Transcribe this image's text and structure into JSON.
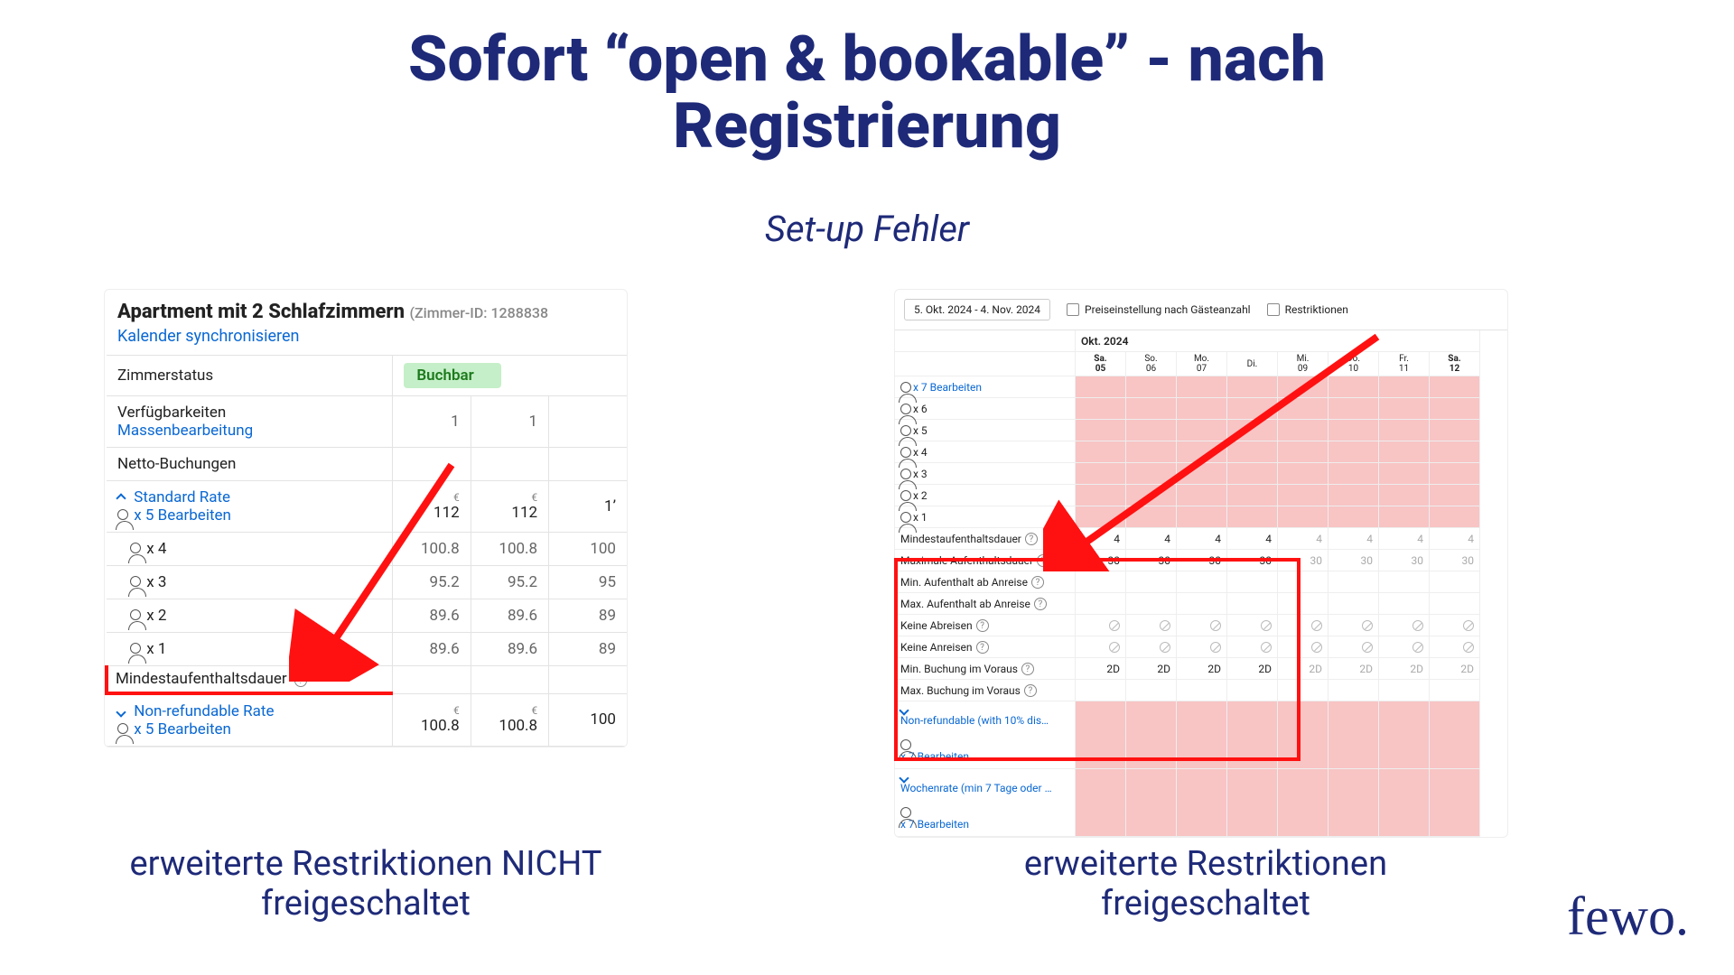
{
  "slide": {
    "title_line1": "Sofort “open & bookable” - nach",
    "title_line2": "Registrierung",
    "subtitle": "Set-up Fehler",
    "caption_left_line1": "erweiterte Restriktionen NICHT",
    "caption_left_line2": "freigeschaltet",
    "caption_right_line1": "erweiterte Restriktionen",
    "caption_right_line2": "freigeschaltet",
    "logo_text": "fewo."
  },
  "left_panel": {
    "apt_title": "Apartment mit 2 Schlafzimmern",
    "room_id_label": "(Zimmer-ID: 1288838",
    "sync_link": "Kalender synchronisieren",
    "status_label": "Zimmerstatus",
    "status_value": "Buchbar",
    "availability_label": "Verfügbarkeiten",
    "mass_edit": "Massenbearbeitung",
    "availability_vals": [
      "1",
      "1",
      ""
    ],
    "net_label": "Netto-Buchungen",
    "rate_std": "Standard Rate",
    "edit_x5": "x 5 Bearbeiten",
    "std_vals": [
      "112",
      "112",
      "1’"
    ],
    "occ4": "x 4",
    "occ4_vals": [
      "100.8",
      "100.8",
      "100"
    ],
    "occ3": "x 3",
    "occ3_vals": [
      "95.2",
      "95.2",
      "95"
    ],
    "occ2": "x 2",
    "occ2_vals": [
      "89.6",
      "89.6",
      "89"
    ],
    "occ1": "x 1",
    "occ1_vals": [
      "89.6",
      "89.6",
      "89"
    ],
    "minstay_label": "Mindestaufenthaltsdauer",
    "rate_nonref": "Non-refundable Rate",
    "nonref_vals": [
      "100.8",
      "100.8",
      "100"
    ]
  },
  "right_panel": {
    "date_range": "5. Okt. 2024 - 4. Nov. 2024",
    "cb_guests": "Preiseinstellung nach Gästeanzahl",
    "cb_restrict": "Restriktionen",
    "month_label": "Okt. 2024",
    "days": [
      {
        "w": "Sa.",
        "d": "05"
      },
      {
        "w": "So.",
        "d": "06"
      },
      {
        "w": "Mo.",
        "d": "07"
      },
      {
        "w": "Di.",
        "d": ""
      },
      {
        "w": "Mi.",
        "d": "09"
      },
      {
        "w": "Do.",
        "d": "10"
      },
      {
        "w": "Fr.",
        "d": "11"
      },
      {
        "w": "Sa.",
        "d": "12"
      }
    ],
    "edit_x7": "x 7 Bearbeiten",
    "occ_rows": [
      "x 6",
      "x 5",
      "x 4",
      "x 3",
      "x 2",
      "x 1"
    ],
    "restrict_rows": {
      "minstay": {
        "label": "Mindestaufenthaltsdauer",
        "vals": [
          "4",
          "4",
          "4",
          "4",
          "4",
          "4",
          "4",
          "4"
        ]
      },
      "maxstay": {
        "label": "Maximale Aufenthaltsdauer",
        "vals": [
          "30",
          "30",
          "30",
          "30",
          "30",
          "30",
          "30",
          "30"
        ]
      },
      "minarr": {
        "label": "Min. Aufenthalt ab Anreise",
        "vals": [
          "",
          "",
          "",
          "",
          "",
          "",
          "",
          ""
        ]
      },
      "maxarr": {
        "label": "Max. Aufenthalt ab Anreise",
        "vals": [
          "",
          "",
          "",
          "",
          "",
          "",
          "",
          ""
        ]
      },
      "nodep": {
        "label": "Keine Abreisen",
        "type": "circle"
      },
      "noarr": {
        "label": "Keine Anreisen",
        "type": "circle"
      },
      "minadv": {
        "label": "Min. Buchung im Voraus",
        "vals": [
          "2D",
          "2D",
          "2D",
          "2D",
          "2D",
          "2D",
          "2D",
          "2D"
        ]
      },
      "maxadv": {
        "label": "Max. Buchung im Voraus",
        "vals": [
          "",
          "",
          "",
          "",
          "",
          "",
          "",
          ""
        ]
      }
    },
    "bottom_rate1": "Non-refundable (with 10% dis…",
    "bottom_rate2": "Wochenrate (min 7 Tage oder …"
  }
}
